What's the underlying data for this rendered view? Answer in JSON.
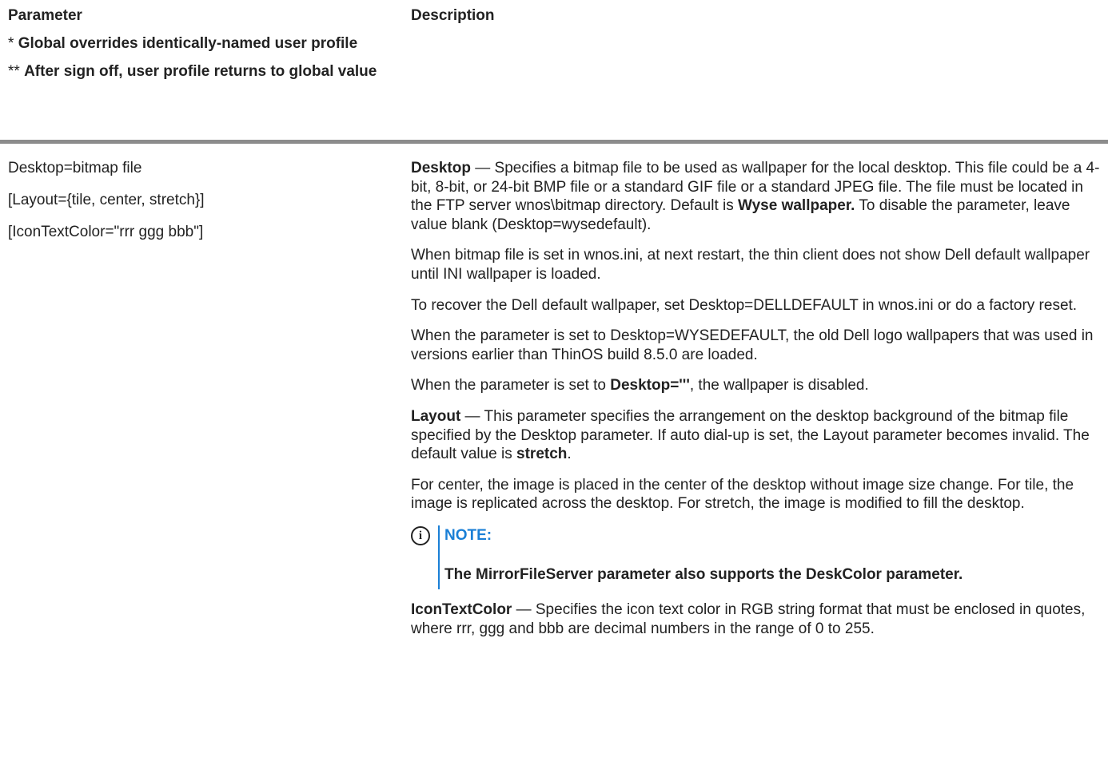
{
  "header": {
    "parameter_title": "Parameter",
    "description_title": "Description",
    "note1_marker": "*",
    "note1_text": "Global overrides identically-named user profile",
    "note2_marker": "**",
    "note2_text": "After sign off, user profile returns to global value"
  },
  "parameters": [
    "Desktop=bitmap file",
    "[Layout={tile, center, stretch}]",
    "[IconTextColor=\"rrr ggg bbb\"]"
  ],
  "description": {
    "desktop": {
      "term": "Desktop",
      "text1": " — Specifies a bitmap file to be used as wallpaper for the local desktop. This file could be a 4-bit, 8-bit, or 24-bit BMP file or a standard GIF file or a standard JPEG file. The file must be located in the FTP server wnos\\bitmap directory. Default is ",
      "default_value": "Wyse wallpaper.",
      "text2": " To disable the parameter, leave value blank (Desktop=wysedefault)."
    },
    "para2": "When bitmap file is set in wnos.ini, at next restart, the thin client does not show Dell default wallpaper until INI wallpaper is loaded.",
    "para3": "To recover the Dell default wallpaper, set Desktop=DELLDEFAULT in wnos.ini or do a factory reset.",
    "para4": "When the parameter is set to Desktop=WYSEDEFAULT, the old Dell logo wallpapers that was used in versions earlier than ThinOS build 8.5.0 are loaded.",
    "para5": {
      "text1": "When the parameter is set to ",
      "value": "Desktop='''",
      "text2": ", the wallpaper is disabled."
    },
    "layout": {
      "term": "Layout",
      "text1": " — This parameter specifies the arrangement on the desktop background of the bitmap file specified by the Desktop parameter. If auto dial-up is set, the Layout parameter becomes invalid. The default value is ",
      "default_value": "stretch",
      "text2": "."
    },
    "para7": "For center, the image is placed in the center of the desktop without image size change. For tile, the image is replicated across the desktop. For stretch, the image is modified to fill the desktop.",
    "note": {
      "icon": "info-icon",
      "icon_glyph": "i",
      "title": "NOTE:",
      "text": "The MirrorFileServer parameter also supports the DeskColor parameter."
    },
    "icontextcolor": {
      "term": "IconTextColor",
      "text1": " — Specifies the icon text color in RGB string format that must be enclosed in quotes, where rrr, ggg and bbb are decimal numbers in the range of 0 to 255."
    }
  },
  "colors": {
    "note_accent": "#1a7fd6",
    "rule": "#8c8c8c",
    "text": "#222222"
  }
}
